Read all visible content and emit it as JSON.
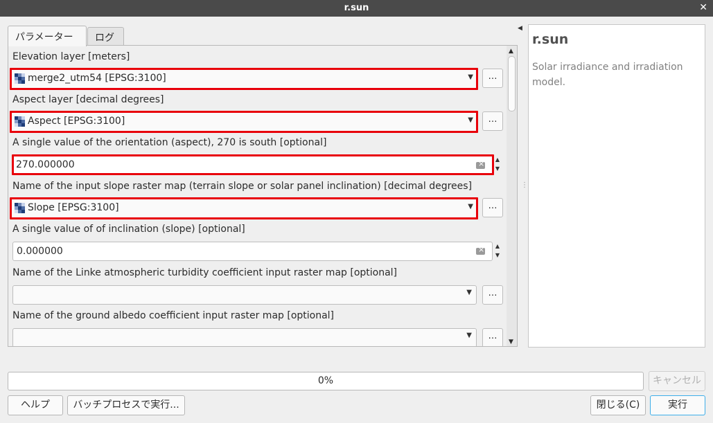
{
  "window": {
    "title": "r.sun"
  },
  "tabs": [
    {
      "label": "パラメーター"
    },
    {
      "label": "ログ"
    }
  ],
  "params": {
    "elevation": {
      "label": "Elevation layer [meters]",
      "value": "merge2_utm54 [EPSG:3100]"
    },
    "aspect": {
      "label": "Aspect layer [decimal degrees]",
      "value": "Aspect [EPSG:3100]"
    },
    "aspect_value": {
      "label": "A single value of the orientation (aspect), 270 is south [optional]",
      "value": "270.000000"
    },
    "slope": {
      "label": "Name of the input slope raster map (terrain slope or solar panel inclination) [decimal degrees]",
      "value": "Slope [EPSG:3100]"
    },
    "slope_value": {
      "label": "A single value of of inclination (slope) [optional]",
      "value": "0.000000"
    },
    "linke": {
      "label": "Name of the Linke atmospheric turbidity coefficient input raster map [optional]",
      "value": ""
    },
    "albedo": {
      "label": "Name of the ground albedo coefficient input raster map [optional]",
      "value": ""
    },
    "browse_label": "…"
  },
  "help": {
    "title": "r.sun",
    "description": "Solar irradiance and irradiation model."
  },
  "progress": {
    "text": "0%",
    "value": 0
  },
  "buttons": {
    "cancel": "キャンセル",
    "help": "ヘルプ",
    "batch": "バッチプロセスで実行...",
    "close": "閉じる(C)",
    "run": "実行"
  },
  "colors": {
    "highlight": "#e8000b",
    "accent": "#3daee9"
  }
}
